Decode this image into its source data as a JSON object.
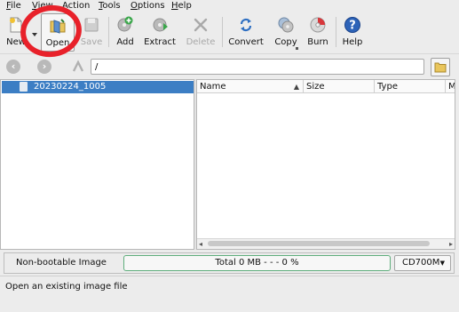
{
  "menubar": {
    "items": [
      {
        "label": "File"
      },
      {
        "label": "View"
      },
      {
        "label": "Action"
      },
      {
        "label": "Tools"
      },
      {
        "label": "Options"
      },
      {
        "label": "Help"
      }
    ]
  },
  "toolbar": {
    "new_label": "New",
    "open_label": "Open",
    "save_label": "Save",
    "add_label": "Add",
    "extract_label": "Extract",
    "delete_label": "Delete",
    "convert_label": "Convert",
    "copy_label": "Copy",
    "burn_label": "Burn",
    "help_label": "Help"
  },
  "location": {
    "path": "/"
  },
  "tree": {
    "selected_item": "20230224_1005"
  },
  "filelist": {
    "columns": [
      "Name",
      "Size",
      "Type",
      "M"
    ]
  },
  "status": {
    "boot_label": "Non-bootable Image",
    "total_text": "Total  0 MB   - - -  0 %",
    "progress_fraction": 0,
    "media_size": "CD700M"
  },
  "hint": {
    "text": "Open an existing image file"
  },
  "colors": {
    "selection": "#3c7ec4",
    "annotation_circle": "#e8212a",
    "progress_border": "#5fae7c"
  }
}
